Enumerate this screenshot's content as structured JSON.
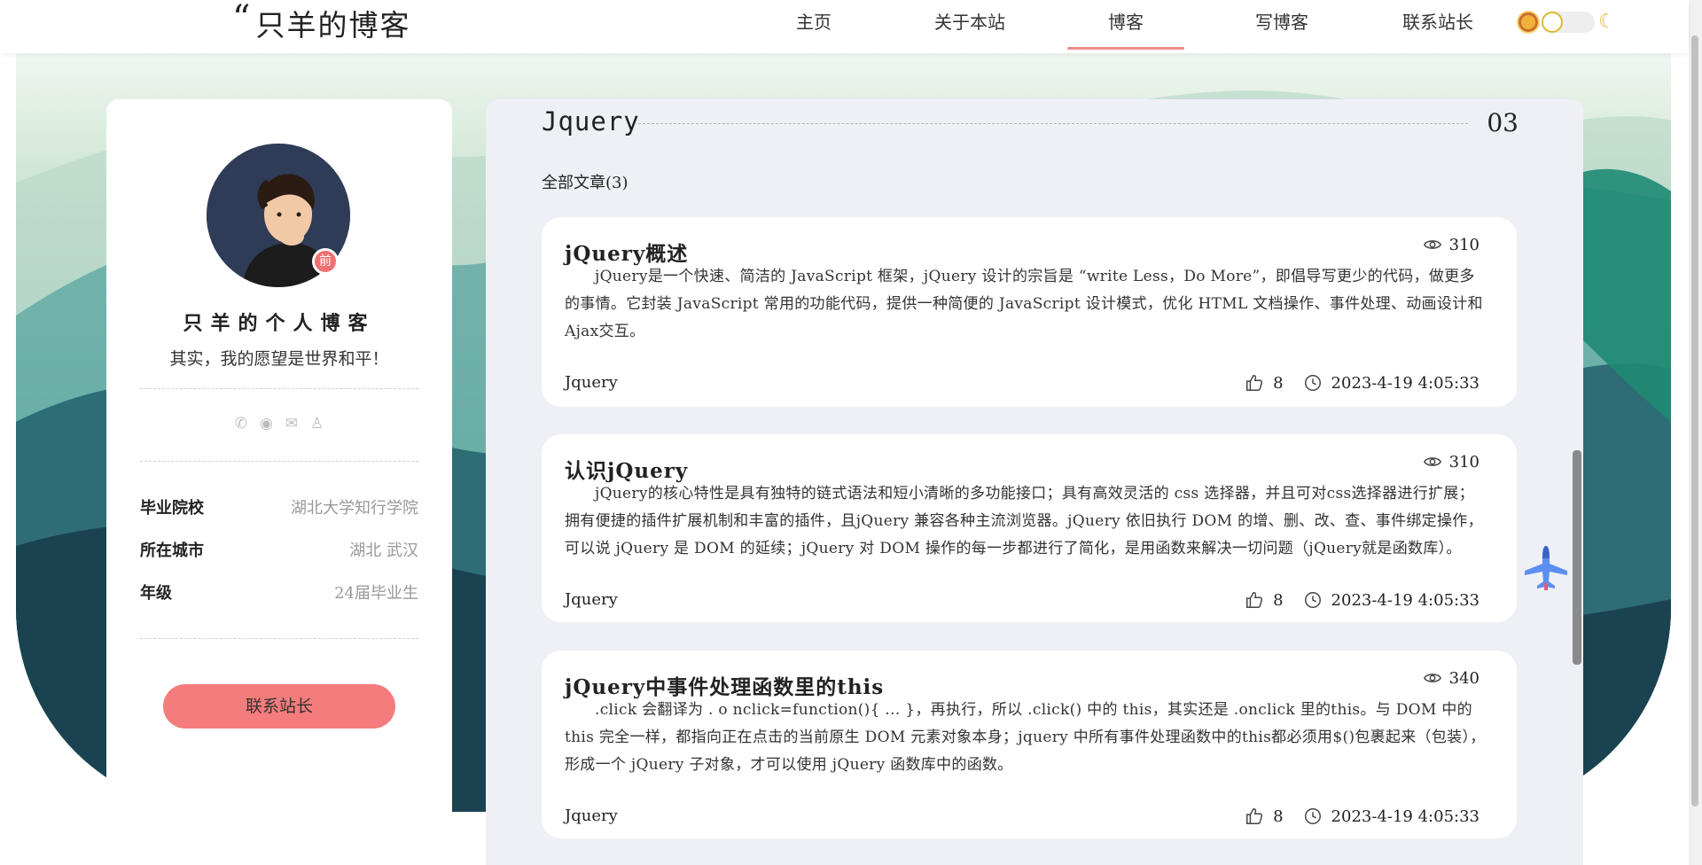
{
  "header": {
    "logo_quote": "“",
    "logo_text": "只羊的博客",
    "nav": [
      {
        "label": "主页"
      },
      {
        "label": "关于本站"
      },
      {
        "label": "博客",
        "active": true
      },
      {
        "label": "写博客"
      },
      {
        "label": "联系站长"
      }
    ],
    "theme_icons": [
      "sun-icon",
      "toggle-switch",
      "moon-icon"
    ]
  },
  "profile": {
    "avatar_badge": "前",
    "blog_title": "只羊的个人博客",
    "motto": "其实，我的愿望是世界和平！",
    "social_icons": [
      "wechat-icon",
      "github-icon",
      "mail-icon",
      "qq-icon"
    ],
    "info": [
      {
        "key": "毕业院校",
        "value": "湖北大学知行学院"
      },
      {
        "key": "所在城市",
        "value": "湖北 武汉"
      },
      {
        "key": "年级",
        "value": "24届毕业生"
      }
    ],
    "contact_button": "联系站长"
  },
  "main": {
    "category": "Jquery",
    "category_count": "03",
    "all_articles": "全部文章(3)",
    "articles": [
      {
        "title": "jQuery概述",
        "views": "310",
        "body": "jQuery是一个快速、简洁的 JavaScript 框架，jQuery 设计的宗旨是 “write Less，Do More”，即倡导写更少的代码，做更多的事情。它封装 JavaScript 常用的功能代码，提供一种简便的 JavaScript 设计模式，优化 HTML 文档操作、事件处理、动画设计和 Ajax交互。",
        "tag": "Jquery",
        "likes": "8",
        "date": "2023-4-19 4:05:33"
      },
      {
        "title": "认识jQuery",
        "views": "310",
        "body": "jQuery的核心特性是具有独特的链式语法和短小清晰的多功能接口；具有高效灵活的 css 选择器，并且可对css选择器进行扩展；拥有便捷的插件扩展机制和丰富的插件，且jQuery 兼容各种主流浏览器。jQuery 依旧执行 DOM 的增、删、改、查、事件绑定操作，可以说 jQuery 是 DOM 的延续；jQuery 对 DOM 操作的每一步都进行了简化，是用函数来解决一切问题（jQuery就是函数库）。",
        "tag": "Jquery",
        "likes": "8",
        "date": "2023-4-19 4:05:33"
      },
      {
        "title": "jQuery中事件处理函数里的this",
        "views": "340",
        "body": ".click 会翻译为 . o nclick=function(){ ... }，再执行，所以 .click() 中的 this，其实还是 .onclick 里的this。与 DOM 中的 this 完全一样，都指向正在点击的当前原生 DOM 元素对象本身；jquery 中所有事件处理函数中的this都必须用$()包裹起来（包装），形成一个 jQuery 子对象，才可以使用 jQuery 函数库中的函数。",
        "tag": "Jquery",
        "likes": "8",
        "date": "2023-4-19 4:05:33"
      }
    ]
  },
  "colors": {
    "accent": "#f47c7c",
    "panel": "#eef0f5",
    "brand_text": "#222222"
  },
  "floating_icon": "plane-icon"
}
